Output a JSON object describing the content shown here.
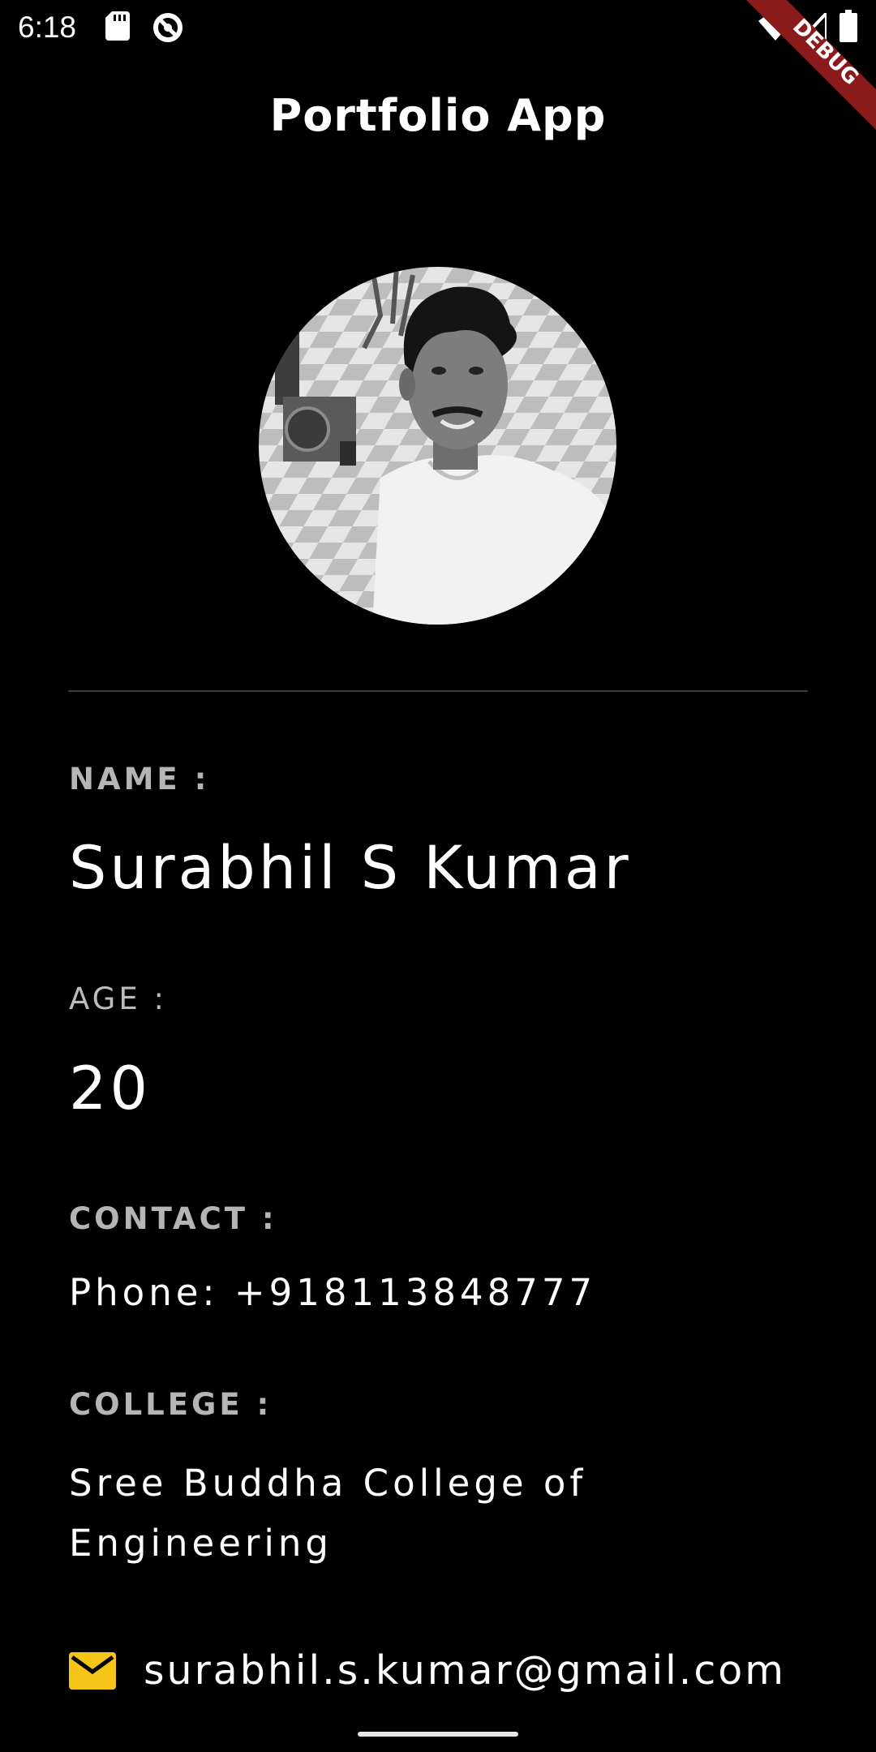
{
  "status_bar": {
    "time": "6:18",
    "icons": [
      "sd-card-icon",
      "sync-icon",
      "wifi-icon",
      "signal-icon",
      "battery-icon"
    ]
  },
  "debug_banner": {
    "label": "DEBUG",
    "color": "#8b1a1a"
  },
  "app_bar": {
    "title": "Portfolio App"
  },
  "profile": {
    "name_label": "NAME :",
    "name": "Surabhil S Kumar",
    "age_label": "AGE :",
    "age": "20",
    "contact_label": "CONTACT :",
    "phone": "Phone: +918113848777",
    "college_label": "COLLEGE :",
    "college_line1": "Sree Buddha College of",
    "college_line2": "Engineering",
    "email": "surabhil.s.kumar@gmail.com",
    "email_icon": "mail-icon"
  },
  "colors": {
    "background": "#000000",
    "label": "#b5b5b5",
    "mail_icon": "#f5c518",
    "debug_ribbon": "#8b1a1a"
  }
}
